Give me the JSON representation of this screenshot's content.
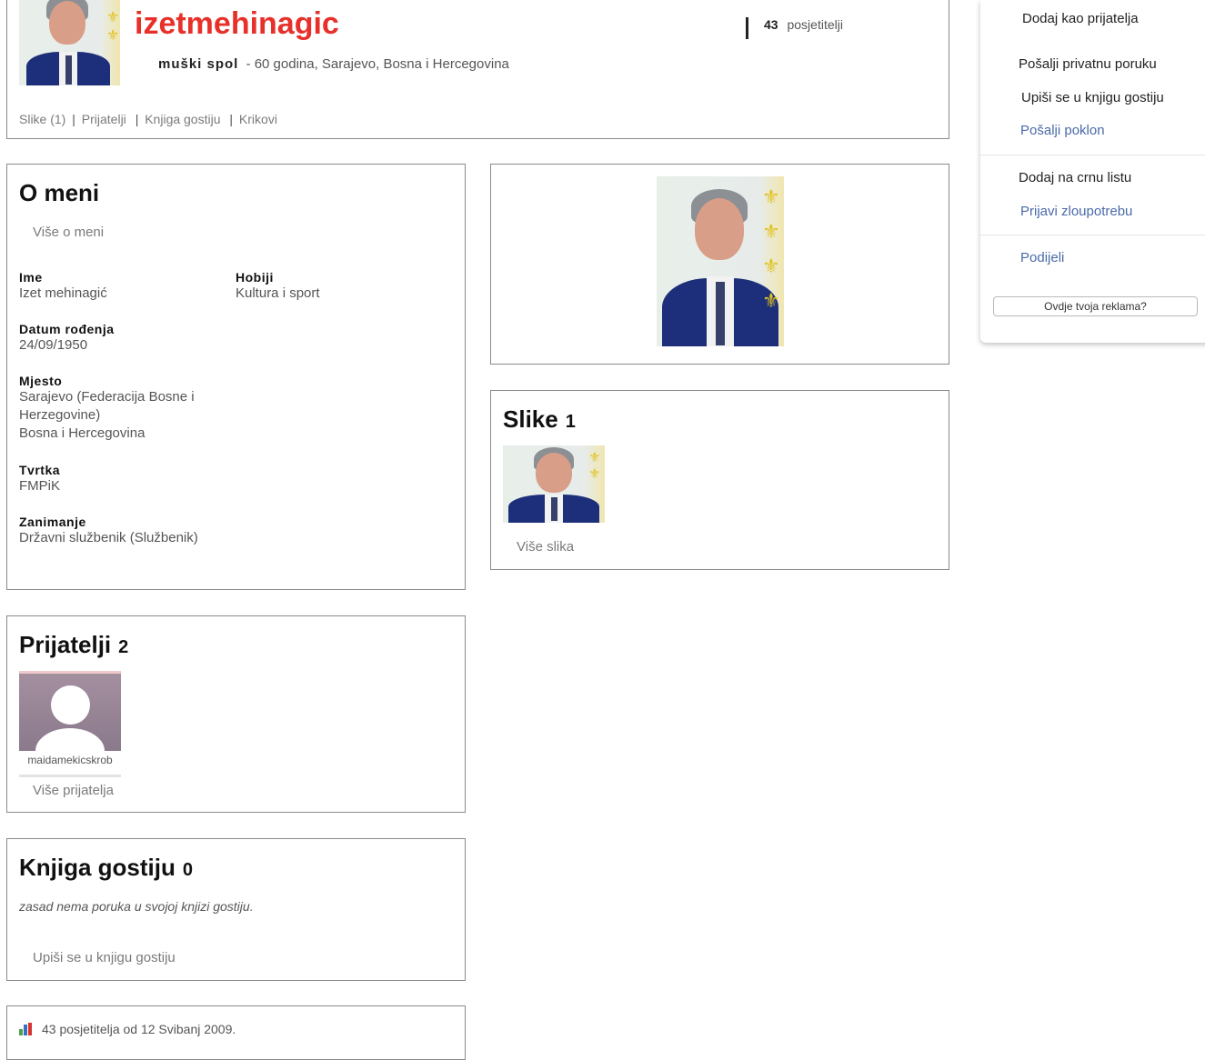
{
  "profile": {
    "username": "izetmehinagic",
    "gender": "muški spol",
    "details": "- 60 godina, Sarajevo, Bosna i Hercegovina",
    "visitors_count": "43",
    "visitors_label": "posjetitelji",
    "nav": [
      "Slike (1)",
      "Prijatelji",
      "Knjiga gostiju",
      "Krikovi"
    ],
    "nav_sep": "|"
  },
  "sidebar": {
    "add_friend": "Dodaj kao prijatelja",
    "private_message": "Pošalji privatnu poruku",
    "sign_guestbook": "Upiši se u knjigu gostiju",
    "send_gift": "Pošalji poklon",
    "blacklist": "Dodaj na crnu listu",
    "report_abuse": "Prijavi zloupotrebu",
    "share": "Podijeli",
    "ad_button": "Ovdje tvoja reklama?"
  },
  "about": {
    "title": "O meni",
    "more_link": "Više o meni",
    "name_label": "Ime",
    "name_value": "Izet mehinagić",
    "hobbies_label": "Hobiji",
    "hobbies_value": "Kultura i sport",
    "birth_label": "Datum rođenja",
    "birth_value": "24/09/1950",
    "place_label": "Mjesto",
    "place_line1": "Sarajevo (Federacija Bosne i",
    "place_line2": "Herzegovine)",
    "place_line3": "Bosna i Hercegovina",
    "company_label": "Tvrtka",
    "company_value": "FMPiK",
    "job_label": "Zanimanje",
    "job_value": "Državni službenik (Službenik)"
  },
  "photos": {
    "title": "Slike",
    "count": "1",
    "more_link": "Više slika"
  },
  "friends": {
    "title": "Prijatelji",
    "count": "2",
    "friend_name": "maidamekicskrob",
    "more_link": "Više prijatelja"
  },
  "guestbook": {
    "title": "Knjiga gostiju",
    "count": "0",
    "empty_text": "zasad nema poruka u svojoj knjizi gostiju.",
    "sign_link": "Upiši se u knjigu gostiju"
  },
  "stats": {
    "text": "43 posjetitelja od 12 Svibanj 2009."
  },
  "colors": {
    "username": "#e8302a",
    "link_gray": "#7a7a7a",
    "link_blue": "#4a6aa8",
    "border": "#8a8a8a"
  }
}
